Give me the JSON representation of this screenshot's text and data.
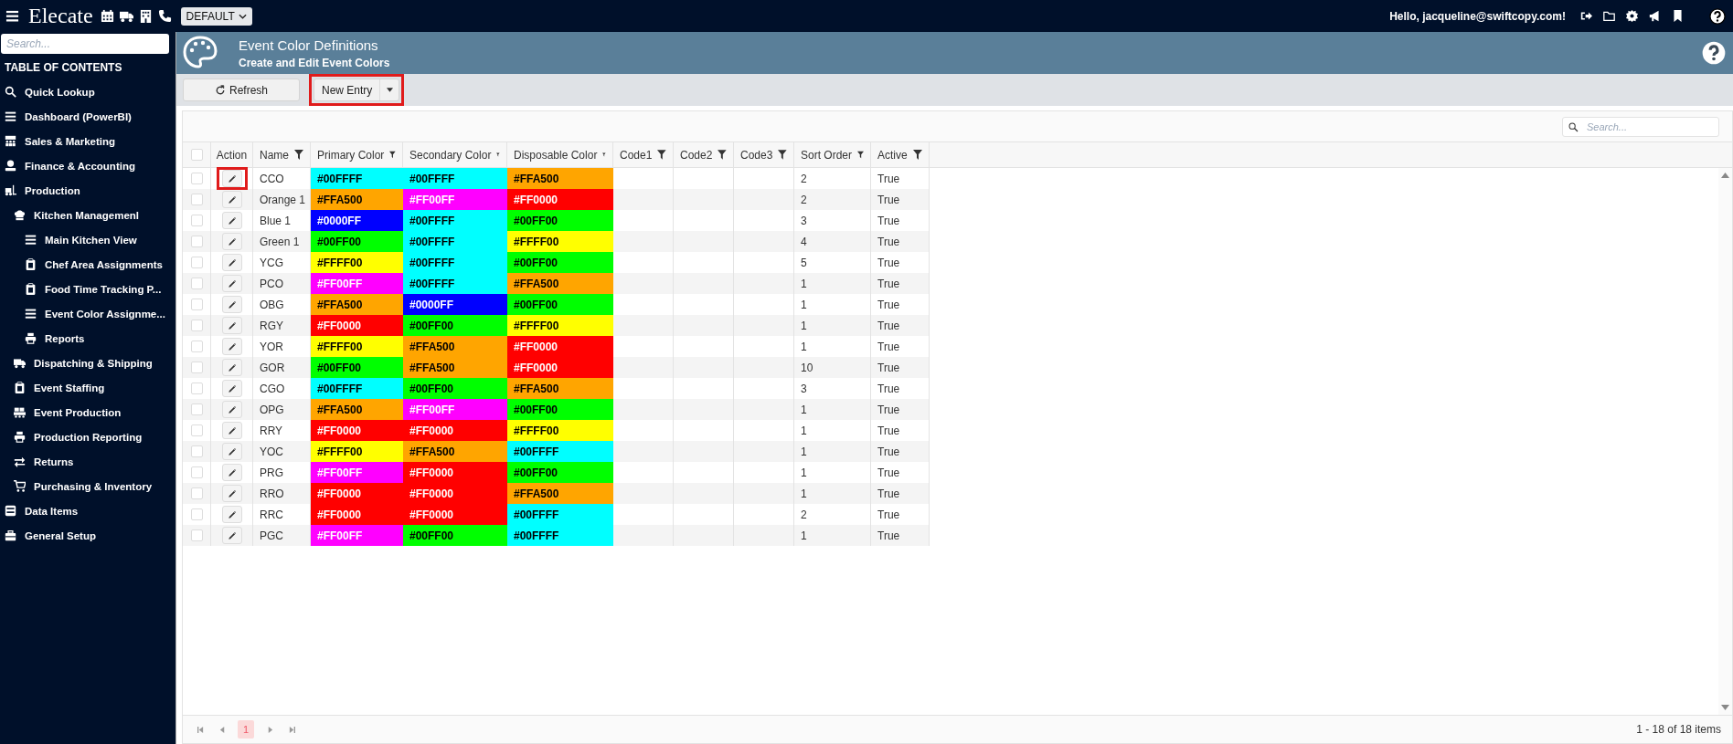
{
  "topbar": {
    "brand": "Elecate",
    "profile": "DEFAULT",
    "greeting": "Hello, jacqueline@swiftcopy.com!"
  },
  "sidebar": {
    "search": {
      "placeholder": "Search..."
    },
    "heading": "TABLE OF CONTENTS",
    "items": [
      {
        "label": "Quick Lookup"
      },
      {
        "label": "Dashboard (PowerBI)"
      },
      {
        "label": "Sales & Marketing"
      },
      {
        "label": "Finance & Accounting"
      },
      {
        "label": "Production",
        "children": [
          {
            "label": "Kitchen Managemenl",
            "children": [
              {
                "label": "Main Kitchen View"
              },
              {
                "label": "Chef Area Assignments"
              },
              {
                "label": "Food Time Tracking P..."
              },
              {
                "label": "Event Color Assignme..."
              },
              {
                "label": "Reports"
              }
            ]
          },
          {
            "label": "Dispatching & Shipping"
          },
          {
            "label": "Event Staffing"
          },
          {
            "label": "Event Production"
          },
          {
            "label": "Production Reporting"
          },
          {
            "label": "Returns"
          },
          {
            "label": "Purchasing & Inventory"
          }
        ]
      },
      {
        "label": "Data Items"
      },
      {
        "label": "General Setup"
      }
    ]
  },
  "page": {
    "title": "Event Color Definitions",
    "subtitle": "Create and Edit Event Colors"
  },
  "toolbar": {
    "refresh": "Refresh",
    "new_entry": {
      "label": "New Entry",
      "highlighted": true
    }
  },
  "grid": {
    "search": {
      "placeholder": "Search..."
    },
    "all_checked": false,
    "columns": [
      "Action",
      "Name",
      "Primary Color",
      "Secondary Color",
      "Disposable Color",
      "Code1",
      "Code2",
      "Code3",
      "Sort Order",
      "Active"
    ],
    "rows": [
      {
        "checked": false,
        "highlighted": true,
        "name": "CCO",
        "primary": {
          "text": "#00FFFF",
          "color": "#00ffff"
        },
        "secondary": {
          "text": "#00FFFF",
          "color": "#00ffff"
        },
        "disposable": {
          "text": "#FFA500",
          "color": "#ffa500"
        },
        "sort_order": "2",
        "active": "True"
      },
      {
        "checked": false,
        "highlighted": false,
        "name": "Orange 1",
        "primary": {
          "text": "#FFA500",
          "color": "#ffa500"
        },
        "secondary": {
          "text": "#FF00FF",
          "color": "#ff00ff"
        },
        "disposable": {
          "text": "#FF0000",
          "color": "#ff0000"
        },
        "sort_order": "2",
        "active": "True"
      },
      {
        "checked": false,
        "highlighted": false,
        "name": "Blue 1",
        "primary": {
          "text": "#0000FF",
          "color": "#0000ff"
        },
        "secondary": {
          "text": "#00FFFF",
          "color": "#00ffff"
        },
        "disposable": {
          "text": "#00FF00",
          "color": "#00ff00"
        },
        "sort_order": "3",
        "active": "True"
      },
      {
        "checked": false,
        "highlighted": false,
        "name": "Green 1",
        "primary": {
          "text": "#00FF00",
          "color": "#00ff00"
        },
        "secondary": {
          "text": "#00FFFF",
          "color": "#00ffff"
        },
        "disposable": {
          "text": "#FFFF00",
          "color": "#ffff00"
        },
        "sort_order": "4",
        "active": "True"
      },
      {
        "checked": false,
        "highlighted": false,
        "name": "YCG",
        "primary": {
          "text": "#FFFF00",
          "color": "#ffff00"
        },
        "secondary": {
          "text": "#00FFFF",
          "color": "#00ffff"
        },
        "disposable": {
          "text": "#00FF00",
          "color": "#00ff00"
        },
        "sort_order": "5",
        "active": "True"
      },
      {
        "checked": false,
        "highlighted": false,
        "name": "PCO",
        "primary": {
          "text": "#FF00FF",
          "color": "#ff00ff"
        },
        "secondary": {
          "text": "#00FFFF",
          "color": "#00ffff"
        },
        "disposable": {
          "text": "#FFA500",
          "color": "#ffa500"
        },
        "sort_order": "1",
        "active": "True"
      },
      {
        "checked": false,
        "highlighted": false,
        "name": "OBG",
        "primary": {
          "text": "#FFA500",
          "color": "#ffa500"
        },
        "secondary": {
          "text": "#0000FF",
          "color": "#0000ff"
        },
        "disposable": {
          "text": "#00FF00",
          "color": "#00ff00"
        },
        "sort_order": "1",
        "active": "True"
      },
      {
        "checked": false,
        "highlighted": false,
        "name": "RGY",
        "primary": {
          "text": "#FF0000",
          "color": "#ff0000"
        },
        "secondary": {
          "text": "#00FF00",
          "color": "#00ff00"
        },
        "disposable": {
          "text": "#FFFF00",
          "color": "#ffff00"
        },
        "sort_order": "1",
        "active": "True"
      },
      {
        "checked": false,
        "highlighted": false,
        "name": "YOR",
        "primary": {
          "text": "#FFFF00",
          "color": "#ffff00"
        },
        "secondary": {
          "text": "#FFA500",
          "color": "#ffa500"
        },
        "disposable": {
          "text": "#FF0000",
          "color": "#ff0000"
        },
        "sort_order": "1",
        "active": "True"
      },
      {
        "checked": false,
        "highlighted": false,
        "name": "GOR",
        "primary": {
          "text": "#00FF00",
          "color": "#00ff00"
        },
        "secondary": {
          "text": "#FFA500",
          "color": "#ffa500"
        },
        "disposable": {
          "text": "#FF0000",
          "color": "#ff0000"
        },
        "sort_order": "10",
        "active": "True"
      },
      {
        "checked": false,
        "highlighted": false,
        "name": "CGO",
        "primary": {
          "text": "#00FFFF",
          "color": "#00ffff"
        },
        "secondary": {
          "text": "#00FF00",
          "color": "#00ff00"
        },
        "disposable": {
          "text": "#FFA500",
          "color": "#ffa500"
        },
        "sort_order": "3",
        "active": "True"
      },
      {
        "checked": false,
        "highlighted": false,
        "name": "OPG",
        "primary": {
          "text": "#FFA500",
          "color": "#ffa500"
        },
        "secondary": {
          "text": "#FF00FF",
          "color": "#ff00ff"
        },
        "disposable": {
          "text": "#00FF00",
          "color": "#00ff00"
        },
        "sort_order": "1",
        "active": "True"
      },
      {
        "checked": false,
        "highlighted": false,
        "name": "RRY",
        "primary": {
          "text": "#FF0000",
          "color": "#ff0000"
        },
        "secondary": {
          "text": "#FF0000",
          "color": "#ff0000"
        },
        "disposable": {
          "text": "#FFFF00",
          "color": "#ffff00"
        },
        "sort_order": "1",
        "active": "True"
      },
      {
        "checked": false,
        "highlighted": false,
        "name": "YOC",
        "primary": {
          "text": "#FFFF00",
          "color": "#ffff00"
        },
        "secondary": {
          "text": "#FFA500",
          "color": "#ffa500"
        },
        "disposable": {
          "text": "#00FFFF",
          "color": "#00ffff"
        },
        "sort_order": "1",
        "active": "True"
      },
      {
        "checked": false,
        "highlighted": false,
        "name": "PRG",
        "primary": {
          "text": "#FF00FF",
          "color": "#ff00ff"
        },
        "secondary": {
          "text": "#FF0000",
          "color": "#ff0000"
        },
        "disposable": {
          "text": "#00FF00",
          "color": "#00ff00"
        },
        "sort_order": "1",
        "active": "True"
      },
      {
        "checked": false,
        "highlighted": false,
        "name": "RRO",
        "primary": {
          "text": "#FF0000",
          "color": "#ff0000"
        },
        "secondary": {
          "text": "#FF0000",
          "color": "#ff0000"
        },
        "disposable": {
          "text": "#FFA500",
          "color": "#ffa500"
        },
        "sort_order": "1",
        "active": "True"
      },
      {
        "checked": false,
        "highlighted": false,
        "name": "RRC",
        "primary": {
          "text": "#FF0000",
          "color": "#ff0000"
        },
        "secondary": {
          "text": "#FF0000",
          "color": "#ff0000"
        },
        "disposable": {
          "text": "#00FFFF",
          "color": "#00ffff"
        },
        "sort_order": "2",
        "active": "True"
      },
      {
        "checked": false,
        "highlighted": false,
        "name": "PGC",
        "primary": {
          "text": "#FF00FF",
          "color": "#ff00ff"
        },
        "secondary": {
          "text": "#00FF00",
          "color": "#00ff00"
        },
        "disposable": {
          "text": "#00FFFF",
          "color": "#00ffff"
        },
        "sort_order": "1",
        "active": "True"
      }
    ],
    "pager": {
      "pages": [
        {
          "label": "1",
          "selected": true
        }
      ],
      "summary": "1 - 18 of 18 items"
    }
  }
}
